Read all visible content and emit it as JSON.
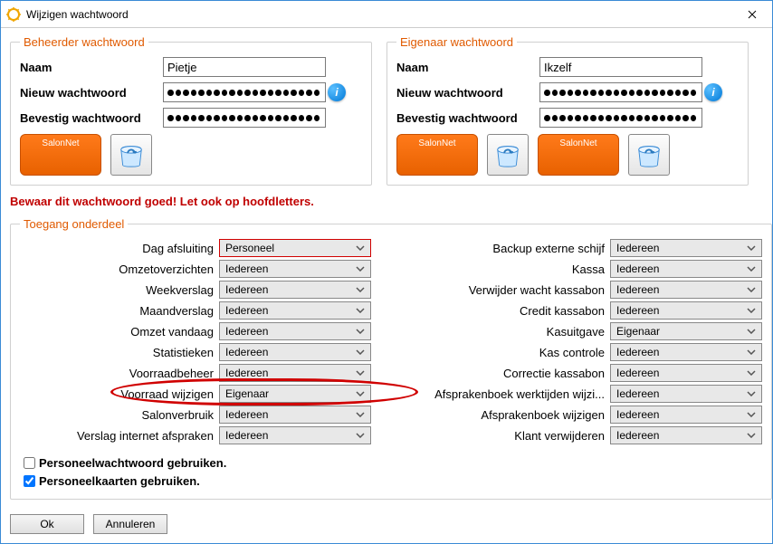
{
  "window": {
    "title": "Wijzigen wachtwoord"
  },
  "admin": {
    "legend": "Beheerder wachtwoord",
    "name_label": "Naam",
    "name_value": "Pietje",
    "new_label": "Nieuw wachtwoord",
    "confirm_label": "Bevestig wachtwoord",
    "btn_label": "SalonNet"
  },
  "owner": {
    "legend": "Eigenaar wachtwoord",
    "name_label": "Naam",
    "name_value": "Ikzelf",
    "new_label": "Nieuw wachtwoord",
    "confirm_label": "Bevestig wachtwoord",
    "btn_label": "SalonNet"
  },
  "warning": "Bewaar dit wachtwoord goed! Let ook op hoofdletters.",
  "access": {
    "legend": "Toegang onderdeel",
    "left": [
      {
        "label": "Dag afsluiting",
        "value": "Personeel",
        "hl": true
      },
      {
        "label": "Omzetoverzichten",
        "value": "Iedereen"
      },
      {
        "label": "Weekverslag",
        "value": "Iedereen"
      },
      {
        "label": "Maandverslag",
        "value": "Iedereen"
      },
      {
        "label": "Omzet vandaag",
        "value": "Iedereen"
      },
      {
        "label": "Statistieken",
        "value": "Iedereen"
      },
      {
        "label": "Voorraadbeheer",
        "value": "Iedereen"
      },
      {
        "label": "Voorraad wijzigen",
        "value": "Eigenaar",
        "circle": true
      },
      {
        "label": "Salonverbruik",
        "value": "Iedereen"
      },
      {
        "label": "Verslag internet afspraken",
        "value": "Iedereen"
      }
    ],
    "right": [
      {
        "label": "Backup externe schijf",
        "value": "Iedereen"
      },
      {
        "label": "Kassa",
        "value": "Iedereen"
      },
      {
        "label": "Verwijder wacht kassabon",
        "value": "Iedereen"
      },
      {
        "label": "Credit kassabon",
        "value": "Iedereen"
      },
      {
        "label": "Kasuitgave",
        "value": "Eigenaar"
      },
      {
        "label": "Kas controle",
        "value": "Iedereen"
      },
      {
        "label": "Correctie kassabon",
        "value": "Iedereen"
      },
      {
        "label": "Afsprakenboek werktijden wijzi...",
        "value": "Iedereen"
      },
      {
        "label": "Afsprakenboek wijzigen",
        "value": "Iedereen"
      },
      {
        "label": "Klant verwijderen",
        "value": "Iedereen"
      }
    ],
    "chk1_label": "Personeelwachtwoord gebruiken.",
    "chk1_checked": false,
    "chk2_label": "Personeelkaarten gebruiken.",
    "chk2_checked": true
  },
  "buttons": {
    "ok": "Ok",
    "cancel": "Annuleren"
  }
}
